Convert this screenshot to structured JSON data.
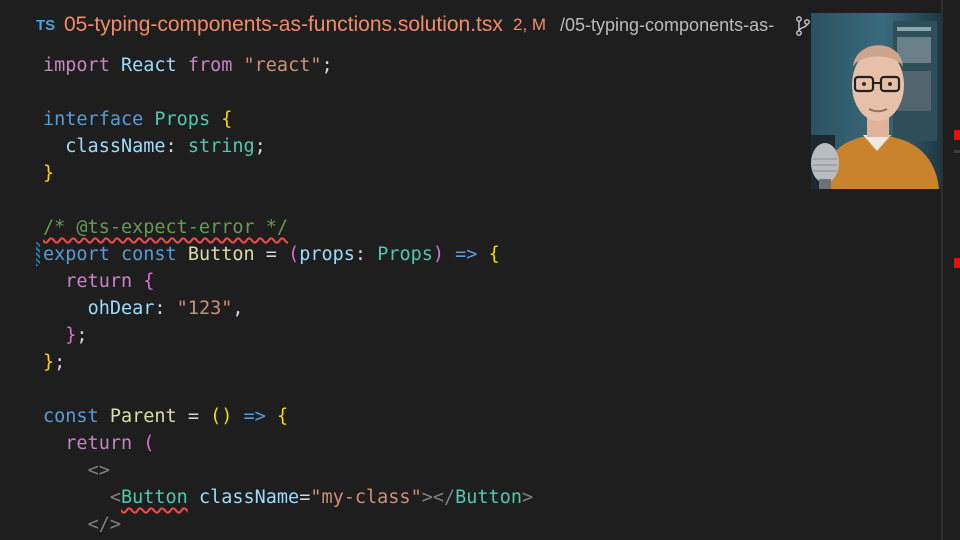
{
  "tab": {
    "lang_badge": "TS",
    "filename": "05-typing-components-as-functions.solution.tsx",
    "status": "2, M",
    "path": "/05-typing-components-as-"
  },
  "colors": {
    "background": "#1e1e1e",
    "keyword": "#569cd6",
    "control": "#c586c0",
    "type": "#4ec9b0",
    "variable": "#9cdcfe",
    "string": "#ce9178",
    "bracket_gold": "#ffd700",
    "comment": "#6a9955",
    "error": "#f14c4c",
    "modified_tab": "#f28b6c"
  },
  "code": {
    "l1": {
      "kw": "import",
      "name": "React",
      "from": "from",
      "str": "\"react\"",
      "semi": ";"
    },
    "l3": {
      "kw": "interface",
      "type": "Props",
      "brace": "{"
    },
    "l4": {
      "prop": "className",
      "colon": ":",
      "type": "string",
      "semi": ";"
    },
    "l5": {
      "brace": "}"
    },
    "l7": {
      "comment": "/* @ts-expect-error */"
    },
    "l8": {
      "export": "export",
      "const": "const",
      "name": "Button",
      "eq": "=",
      "paren_open": "(",
      "param": "props",
      "colon": ":",
      "type": "Props",
      "paren_close": ")",
      "arrow": "=>",
      "brace": "{"
    },
    "l9": {
      "ret": "return",
      "brace": "{"
    },
    "l10": {
      "prop": "ohDear",
      "colon": ":",
      "str": "\"123\"",
      "comma": ","
    },
    "l11": {
      "brace": "}",
      "semi": ";"
    },
    "l12": {
      "brace": "}",
      "semi": ";"
    },
    "l14": {
      "const": "const",
      "name": "Parent",
      "eq": "=",
      "parens": "()",
      "arrow": "=>",
      "brace": "{"
    },
    "l15": {
      "ret": "return",
      "paren": "("
    },
    "l16": {
      "frag_open": "<>"
    },
    "l17": {
      "lt": "<",
      "comp": "Button",
      "attr": "className",
      "eq": "=",
      "str": "\"my-class\"",
      "gt_close": "></",
      "comp_close": "Button",
      "gt": ">"
    },
    "l18": {
      "frag_close": "</>"
    }
  }
}
